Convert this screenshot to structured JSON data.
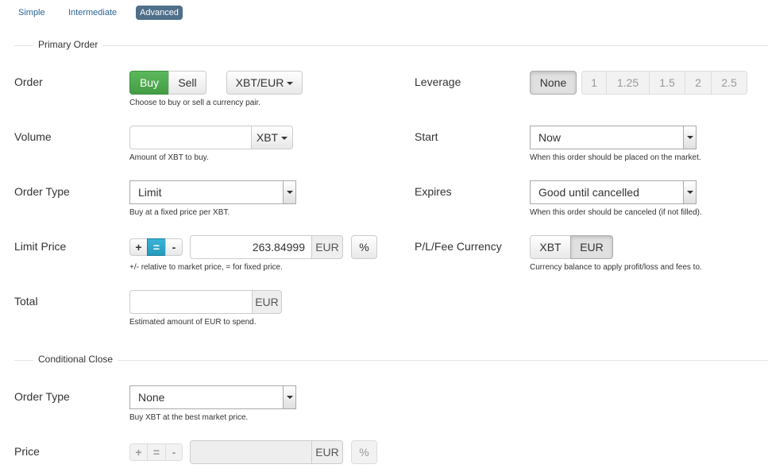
{
  "modes": [
    "Simple",
    "Intermediate",
    "Advanced"
  ],
  "primary": {
    "title": "Primary Order",
    "order_label": "Order",
    "buy": "Buy",
    "sell": "Sell",
    "pair": "XBT/EUR",
    "order_help": "Choose to buy or sell a currency pair.",
    "volume_label": "Volume",
    "volume_value": "",
    "volume_currency": "XBT",
    "volume_help": "Amount of XBT to buy.",
    "type_label": "Order Type",
    "type_value": "Limit",
    "type_help": "Buy at a fixed price per XBT.",
    "limit_label": "Limit Price",
    "plus": "+",
    "equals": "=",
    "minus": "-",
    "limit_value": "263.84999",
    "limit_currency": "EUR",
    "percent": "%",
    "limit_help": "+/- relative to market price, = for fixed price.",
    "total_label": "Total",
    "total_value": "",
    "total_currency": "EUR",
    "total_help": "Estimated amount of EUR to spend.",
    "leverage_label": "Leverage",
    "leverage_options": [
      "None",
      "1",
      "1.25",
      "1.5",
      "2",
      "2.5"
    ],
    "start_label": "Start",
    "start_value": "Now",
    "start_help": "When this order should be placed on the market.",
    "expires_label": "Expires",
    "expires_value": "Good until cancelled",
    "expires_help": "When this order should be canceled (if not filled).",
    "fee_label": "P/L/Fee Currency",
    "fee_xbt": "XBT",
    "fee_eur": "EUR",
    "fee_help": "Currency balance to apply profit/loss and fees to."
  },
  "conditional": {
    "title": "Conditional Close",
    "type_label": "Order Type",
    "type_value": "None",
    "type_help": "Buy XBT at the best market price.",
    "price_label": "Price",
    "plus": "+",
    "equals": "=",
    "minus": "-",
    "price_value": "",
    "price_currency": "EUR",
    "percent": "%"
  }
}
